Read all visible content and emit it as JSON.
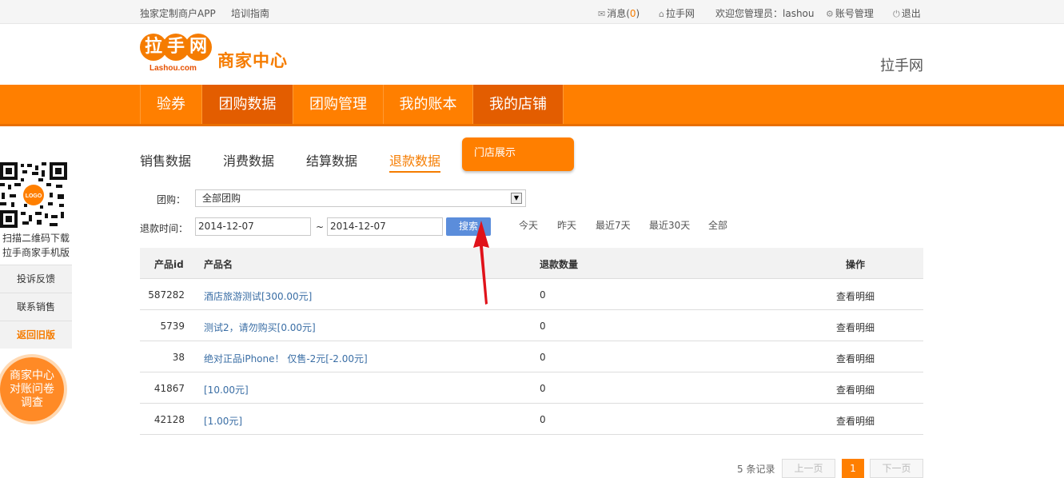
{
  "topbar": {
    "app_link": "独家定制商户APP",
    "training_link": "培训指南",
    "messages_label": "消息(",
    "messages_count": "0",
    "messages_close": ")",
    "lashou_link": "拉手网",
    "welcome": "欢迎您管理员：lashou",
    "account_link": "账号管理",
    "logout_link": "退出"
  },
  "header": {
    "logo_char1": "拉",
    "logo_char2": "手",
    "logo_char3": "网",
    "logo_sub": "Lashou.com",
    "title": "商家中心",
    "right_text": "拉手网"
  },
  "nav": {
    "items": [
      {
        "label": "验券"
      },
      {
        "label": "团购数据"
      },
      {
        "label": "团购管理"
      },
      {
        "label": "我的账本"
      },
      {
        "label": "我的店铺"
      }
    ]
  },
  "subtabs": {
    "items": [
      {
        "label": "销售数据"
      },
      {
        "label": "消费数据"
      },
      {
        "label": "结算数据"
      },
      {
        "label": "退款数据"
      }
    ],
    "popup_item": "门店展示"
  },
  "sidebar": {
    "qr_caption_line1": "扫描二维码下载",
    "qr_caption_line2": "拉手商家手机版",
    "qr_center": "LOGO",
    "feedback": "投诉反馈",
    "contact": "联系销售",
    "old_version": "返回旧版",
    "survey_line1": "商家中心",
    "survey_line2": "对账问卷",
    "survey_line3": "调查"
  },
  "filter": {
    "group_label": "团购：",
    "group_value": "全部团购",
    "refund_time_label": "退款时间：",
    "start_date": "2014-12-07",
    "separator": "~",
    "end_date": "2014-12-07",
    "search_button": "搜索",
    "quick": [
      "今天",
      "昨天",
      "最近7天",
      "最近30天",
      "全部"
    ]
  },
  "table": {
    "headers": {
      "id": "产品id",
      "name": "产品名",
      "refund_qty": "退款数量",
      "action": "操作"
    },
    "rows": [
      {
        "id": "587282",
        "name": "酒店旅游测试[300.00元]",
        "qty": "0",
        "action": "查看明细"
      },
      {
        "id": "5739",
        "name": "测试2，请勿购买[0.00元]",
        "qty": "0",
        "action": "查看明细"
      },
      {
        "id": "38",
        "name": "绝对正品iPhone！ 仅售-2元[-2.00元]",
        "qty": "0",
        "action": "查看明细"
      },
      {
        "id": "41867",
        "name": "[10.00元]",
        "qty": "0",
        "action": "查看明细"
      },
      {
        "id": "42128",
        "name": "[1.00元]",
        "qty": "0",
        "action": "查看明细"
      }
    ]
  },
  "pager": {
    "count": "5 条记录",
    "prev": "上一页",
    "current": "1",
    "next": "下一页"
  },
  "colors": {
    "brand_orange": "#ff7f00",
    "nav_active": "#e35d00",
    "search_blue": "#5b8ddb",
    "annotation_arrow": "#e0121a"
  }
}
